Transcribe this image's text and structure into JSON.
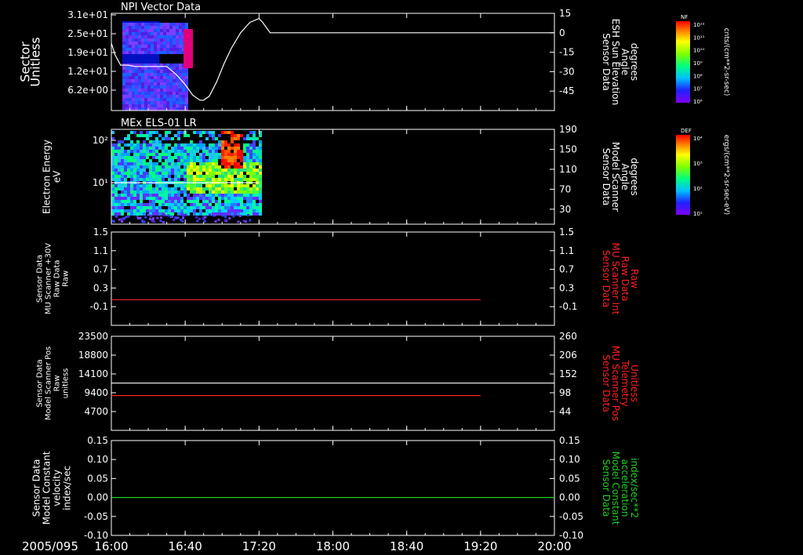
{
  "colors": {
    "background": "#000000",
    "axis": "#ffffff",
    "white_trace": "#ffffff",
    "red_trace": "#ff2020",
    "green_trace": "#20d020",
    "red_label": "#ff2020",
    "green_label": "#20d020"
  },
  "time_axis": {
    "date_label": "2005/095",
    "start_min": 960,
    "end_min": 1200,
    "ticks": [
      {
        "min": 960,
        "label": "16:00"
      },
      {
        "min": 1000,
        "label": "16:40"
      },
      {
        "min": 1040,
        "label": "17:20"
      },
      {
        "min": 1080,
        "label": "18:00"
      },
      {
        "min": 1120,
        "label": "18:40"
      },
      {
        "min": 1160,
        "label": "19:20"
      },
      {
        "min": 1200,
        "label": "20:00"
      }
    ]
  },
  "chart_data": [
    {
      "type": "heatmap",
      "title": "NPI Vector Data",
      "left_axis": {
        "label_lines": [
          "Sector",
          "Unitless"
        ],
        "ticks": [
          "3.1e+01",
          "2.5e+01",
          "1.9e+01",
          "1.2e+01",
          "6.2e+00"
        ]
      },
      "right_axis": {
        "label_lines": [
          "Sensor Data",
          "ESH Sun Elevation",
          "Angle",
          "degrees"
        ],
        "ticks": [
          15,
          0,
          -15,
          -30,
          -45
        ],
        "range": [
          -60,
          15
        ]
      },
      "colorbar": {
        "name": "NF",
        "unit": "cnts/(cm**2-sr-sec)",
        "ticks": [
          "10¹²",
          "10¹¹",
          "10¹⁰",
          "10⁹",
          "10⁸",
          "10⁷",
          "10⁶"
        ]
      },
      "data_extent_min": [
        960,
        986
      ],
      "line_series": {
        "name": "ESH Sun Elevation Angle",
        "axis": "right",
        "t_min": [
          960,
          962,
          965,
          969,
          973,
          975,
          978,
          980,
          983,
          986,
          990,
          995,
          1000,
          1004,
          1008,
          1010,
          1013,
          1017,
          1021,
          1025,
          1030,
          1035,
          1040,
          1042,
          1046,
          1050,
          1055,
          1160,
          1200
        ],
        "values": [
          -8,
          -17,
          -25,
          -25,
          -26,
          -26,
          -26,
          -26,
          -26,
          -26,
          -26,
          -32,
          -40,
          -48,
          -52,
          -52,
          -49,
          -38,
          -24,
          -12,
          0,
          8,
          11,
          8,
          0,
          0,
          0,
          0,
          0
        ]
      }
    },
    {
      "type": "heatmap",
      "title": "MEx ELS-01 LR",
      "left_axis": {
        "label_lines": [
          "Electron Energy",
          "eV"
        ],
        "scale": "log",
        "ticks": [
          "10²",
          "10¹"
        ]
      },
      "right_axis": {
        "label_lines": [
          "Sensor Data",
          "Model Scanner",
          "Angle",
          "degrees"
        ],
        "ticks": [
          190,
          150,
          110,
          70,
          30
        ],
        "range": [
          0,
          190
        ]
      },
      "colorbar": {
        "name": "DEF",
        "unit": "ergs/(cm**2-sr-sec-eV)",
        "ticks": [
          "10⁴",
          "10³",
          "10²",
          "10¹"
        ]
      },
      "data_extent_min": [
        960,
        1040
      ],
      "line_series": {
        "name": "Model Scanner Angle",
        "axis": "right",
        "t_min": [
          960,
          1040
        ],
        "values": [
          83,
          83
        ]
      }
    },
    {
      "type": "line",
      "left_axis": {
        "label_lines": [
          "Sensor Data",
          "MU Scanner +30V",
          "Raw Data",
          "Raw"
        ],
        "ticks": [
          1.5,
          1.1,
          0.7,
          0.3,
          -0.1
        ],
        "tick_labels": [
          "1.5",
          "1.1",
          "0.7",
          "0.3",
          "-0.1"
        ],
        "range": [
          -0.5,
          1.5
        ]
      },
      "right_axis": {
        "label_lines": [
          "Sensor Data",
          "MU Scanner Int",
          "Raw Data",
          "Raw"
        ],
        "color": "red",
        "ticks": [
          1.5,
          1.1,
          0.7,
          0.3,
          -0.1
        ],
        "tick_labels": [
          "1.5",
          "1.1",
          "0.7",
          "0.3",
          "-0.1"
        ],
        "range": [
          -0.5,
          1.5
        ]
      },
      "series": [
        {
          "axis": "left",
          "color": "red",
          "t_min": [
            960,
            1160
          ],
          "values": [
            0.05,
            0.05
          ]
        }
      ]
    },
    {
      "type": "line",
      "left_axis": {
        "label_lines": [
          "Sensor Data",
          "Model Scanner Pos",
          "Raw",
          "unitless"
        ],
        "ticks": [
          23500,
          18800,
          14100,
          9400,
          4700
        ],
        "tick_labels": [
          "23500",
          "18800",
          "14100",
          "9400",
          "4700"
        ],
        "range": [
          0,
          23500
        ]
      },
      "right_axis": {
        "label_lines": [
          "Sensor Data",
          "MU Scanner Pos",
          "Telemetry",
          "Unitless"
        ],
        "color": "red",
        "ticks": [
          260,
          206,
          152,
          98,
          44
        ],
        "tick_labels": [
          "260",
          "206",
          "152",
          "98",
          "44"
        ],
        "range": [
          -10,
          260
        ]
      },
      "series": [
        {
          "axis": "left",
          "color": "white",
          "t_min": [
            960,
            1200
          ],
          "values": [
            11800,
            11800
          ]
        },
        {
          "axis": "right",
          "color": "red",
          "t_min": [
            960,
            1160
          ],
          "values": [
            90,
            90
          ]
        }
      ]
    },
    {
      "type": "line",
      "left_axis": {
        "label_lines": [
          "Sensor Data",
          "Model Constant",
          "velocity",
          "index/sec"
        ],
        "ticks": [
          0.15,
          0.1,
          0.05,
          0.0,
          -0.05,
          -0.1
        ],
        "tick_labels": [
          "0.15",
          "0.10",
          "0.05",
          "0.00",
          "-0.05",
          "-0.10"
        ],
        "range": [
          -0.1,
          0.15
        ]
      },
      "right_axis": {
        "label_lines": [
          "Sensor Data",
          "Model Constant",
          "acceleration",
          "index/sec**2"
        ],
        "color": "green",
        "ticks": [
          0.15,
          0.1,
          0.05,
          0.0,
          -0.05,
          -0.1
        ],
        "tick_labels": [
          "0.15",
          "0.10",
          "0.05",
          "0.00",
          "-0.05",
          "-0.10"
        ],
        "range": [
          -0.1,
          0.15
        ]
      },
      "series": [
        {
          "axis": "left",
          "color": "green",
          "t_min": [
            960,
            1200
          ],
          "values": [
            0.0,
            0.0
          ]
        }
      ]
    }
  ]
}
